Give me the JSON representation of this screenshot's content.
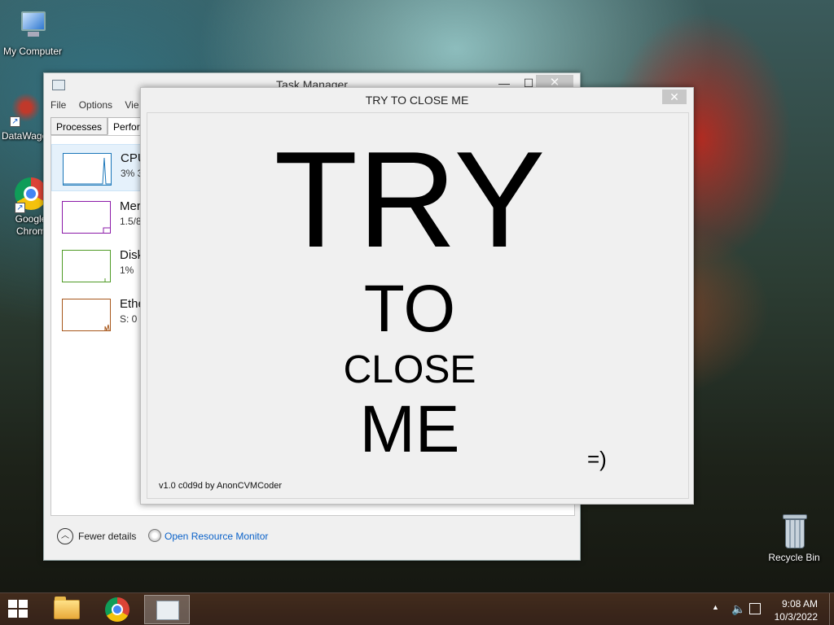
{
  "desktop": {
    "icons": [
      {
        "label": "My Computer",
        "icon": "computer-icon"
      },
      {
        "label": "DataWage",
        "icon": "datawage-icon"
      },
      {
        "label": "Google Chrom",
        "icon": "chrome-icon"
      },
      {
        "label": "Recycle Bin",
        "icon": "recycle-bin-icon"
      }
    ]
  },
  "task_manager": {
    "title": "Task Manager",
    "controls": {
      "minimize": "—",
      "maximize": "☐",
      "close": "✕"
    },
    "menu": [
      "File",
      "Options",
      "Vie"
    ],
    "tabs": [
      "Processes",
      "Perform"
    ],
    "perf_items": [
      {
        "name": "CPU",
        "sub": "3% 3",
        "color": "#1a76b9"
      },
      {
        "name": "Mer",
        "sub": "1.5/8",
        "color": "#8b1aa8"
      },
      {
        "name": "Disk",
        "sub": "1%",
        "color": "#4f9b25"
      },
      {
        "name": "Ethe",
        "sub": "S: 0 F",
        "color": "#a7571b"
      }
    ],
    "footer": {
      "fewer_details": "Fewer details",
      "fewer_icon": "chevron-up-icon",
      "resource_monitor": "Open Resource Monitor"
    }
  },
  "prank_window": {
    "title": "TRY TO CLOSE ME",
    "close": "✕",
    "words": [
      "TRY",
      "TO",
      "CLOSE",
      "ME"
    ],
    "smiley": "=)",
    "version": "v1.0 c0d9d by AnonCVMCoder"
  },
  "taskbar": {
    "clock_time": "9:08 AM",
    "clock_date": "10/3/2022",
    "tray_arrow": "▲",
    "tray_speaker": "🔈"
  }
}
